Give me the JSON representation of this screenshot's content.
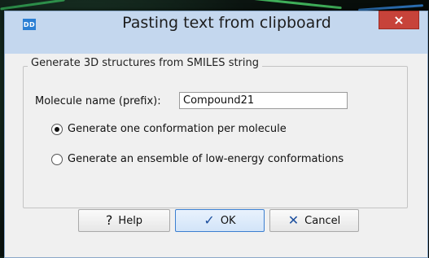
{
  "window": {
    "app_icon": "DD",
    "title": "Pasting text from clipboard",
    "close_glyph": "×"
  },
  "group": {
    "title": "Generate 3D structures from SMILES string"
  },
  "molecule_name": {
    "label": "Molecule name (prefix):",
    "value": "Compound21"
  },
  "options": [
    {
      "label": "Generate one conformation per molecule",
      "checked": true
    },
    {
      "label": "Generate an ensemble of low-energy conformations",
      "checked": false
    }
  ],
  "buttons": {
    "help": {
      "icon": "?",
      "label": "Help"
    },
    "ok": {
      "icon": "✓",
      "label": "OK"
    },
    "cancel": {
      "icon": "✕",
      "label": "Cancel"
    }
  },
  "colors": {
    "titlebar": "#c4d7ee",
    "close": "#c7433a",
    "ok_icon": "#1d4f9e",
    "cancel_icon": "#1d4f9e"
  }
}
